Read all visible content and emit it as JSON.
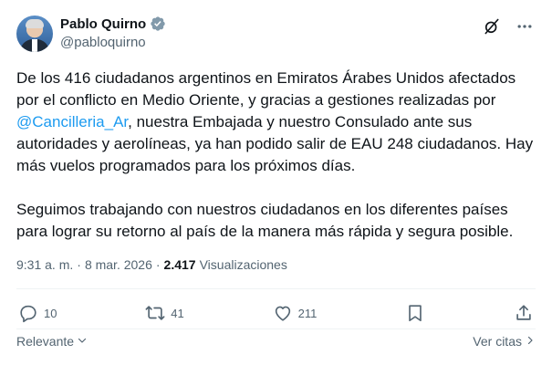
{
  "author": {
    "display_name": "Pablo Quirno",
    "handle": "@pabloquirno"
  },
  "tweet": {
    "p1_before": "De los 416 ciudadanos argentinos en Emiratos Árabes Unidos afectados por el conflicto en Medio Oriente, y gracias a gestiones realizadas por ",
    "mention": "@Cancilleria_Ar",
    "p1_after": ", nuestra Embajada y nuestro Consulado ante sus autoridades y aerolíneas, ya han podido salir de EAU 248 ciudadanos. Hay más vuelos programados para los próximos días.",
    "p2": "Seguimos trabajando con nuestros ciudadanos en los diferentes países para lograr su retorno al país de la manera más rápida y segura posible."
  },
  "meta": {
    "time": "9:31 a. m.",
    "separator1": "·",
    "date": "8 mar. 2026",
    "separator2": "·",
    "views_count": "2.417",
    "views_label": "Visualizaciones"
  },
  "actions": {
    "replies": "10",
    "reposts": "41",
    "likes": "211"
  },
  "footer": {
    "sort_label": "Relevante",
    "quotes_label": "Ver citas"
  },
  "colors": {
    "accent": "#1d9bf0",
    "secondary_text": "#536471",
    "verified_badge": "#829aab"
  },
  "icons": {
    "verified": "verified-badge-icon",
    "grok": "grok-icon",
    "more": "more-icon",
    "reply": "reply-icon",
    "repost": "repost-icon",
    "like": "heart-icon",
    "bookmark": "bookmark-icon",
    "share": "share-icon",
    "sort_chevron": "chevron-down-icon",
    "quotes_chevron": "chevron-right-icon"
  }
}
